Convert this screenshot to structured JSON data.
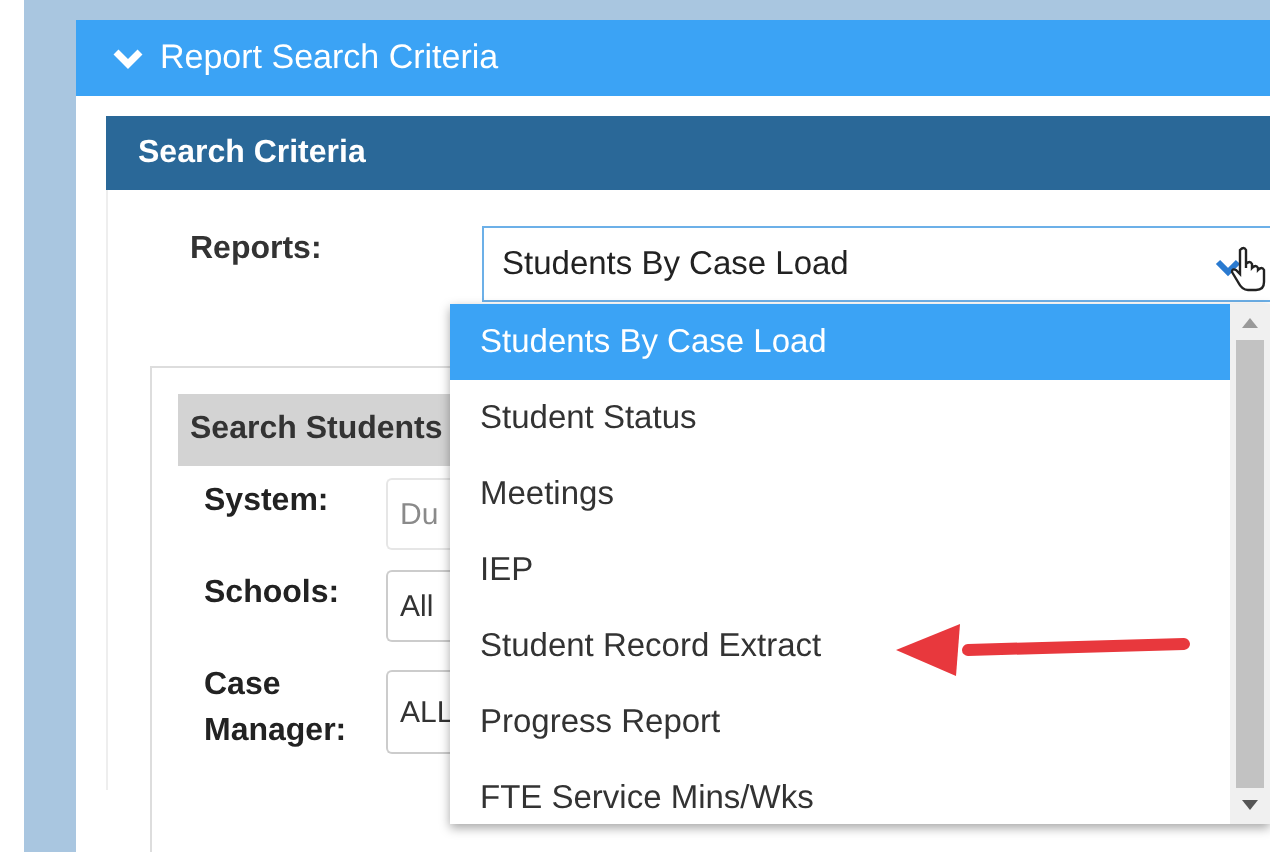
{
  "panel": {
    "title": "Report Search Criteria",
    "expanded": true
  },
  "section": {
    "title": "Search Criteria"
  },
  "reports": {
    "label": "Reports:",
    "value": "Students By Case Load",
    "open": true,
    "options": [
      {
        "label": "Students By Case Load",
        "selected": true
      },
      {
        "label": "Student Status",
        "selected": false
      },
      {
        "label": "Meetings",
        "selected": false
      },
      {
        "label": "IEP",
        "selected": false
      },
      {
        "label": "Student Record Extract",
        "selected": false
      },
      {
        "label": "Progress Report",
        "selected": false
      },
      {
        "label": "FTE Service Mins/Wks",
        "selected": false
      }
    ]
  },
  "search_students": {
    "title": "Search Students",
    "fields": [
      {
        "label": "System:",
        "value": "Du",
        "disabled": true
      },
      {
        "label": "Schools:",
        "value": "All",
        "disabled": false
      },
      {
        "label": "Case Manager:",
        "value": "ALL",
        "disabled": false
      }
    ]
  }
}
